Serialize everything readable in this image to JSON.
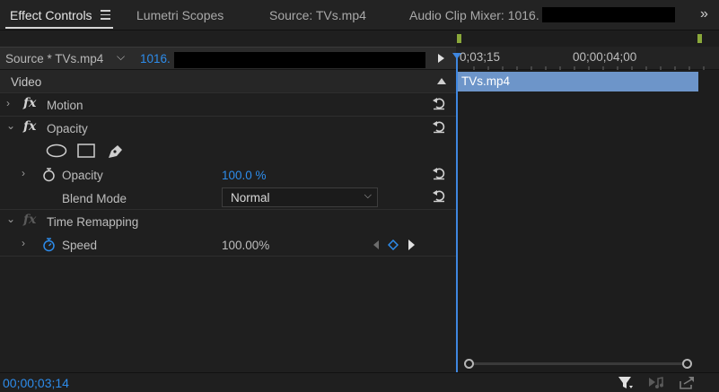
{
  "tabs": [
    {
      "label": "Effect Controls",
      "active": true
    },
    {
      "label": "Lumetri Scopes",
      "active": false
    },
    {
      "label": "Source: TVs.mp4",
      "active": false
    },
    {
      "label": "Audio Clip Mixer: 1016.",
      "active": false
    }
  ],
  "clip_header": {
    "source_label": "Source * TVs.mp4",
    "sequence_label": "1016."
  },
  "timeline": {
    "ruler_labels": [
      "0;03;15",
      "00;00;04;00"
    ],
    "clip_name": "TVs.mp4"
  },
  "effects": {
    "video_header": "Video",
    "motion": {
      "label": "Motion"
    },
    "opacity": {
      "label": "Opacity",
      "param_label": "Opacity",
      "param_value": "100.0 %",
      "blend_label": "Blend Mode",
      "blend_value": "Normal"
    },
    "time_remapping": {
      "label": "Time Remapping",
      "speed_label": "Speed",
      "speed_value": "100.00%"
    }
  },
  "status": {
    "timecode": "00;00;03;14"
  },
  "colors": {
    "accent_blue": "#2d8ceb",
    "clip_blue": "#6d95c9",
    "marker_green": "#8aa83a"
  }
}
